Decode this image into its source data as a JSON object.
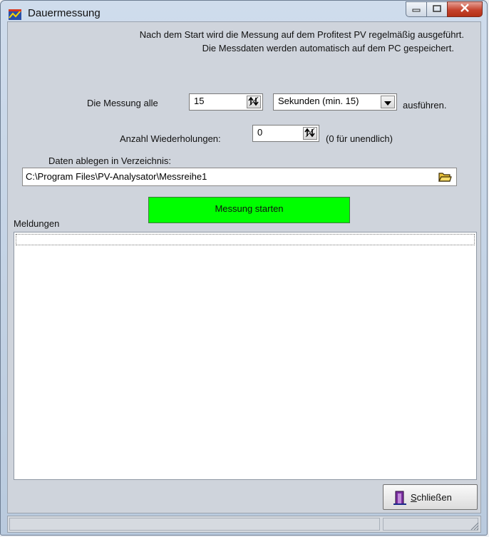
{
  "window": {
    "title": "Dauermessung"
  },
  "intro": {
    "line1": "Nach dem Start wird die Messung auf dem Profitest PV regelmäßig ausgeführt.",
    "line2": "Die Messdaten werden automatisch auf dem PC gespeichert."
  },
  "interval": {
    "prefix": "Die Messung alle",
    "value": "15",
    "unit_selected": "Sekunden (min. 15)",
    "suffix": "ausführen."
  },
  "repeat": {
    "label": "Anzahl Wiederholungen:",
    "value": "0",
    "hint": "(0 für unendlich)"
  },
  "directory": {
    "label": "Daten ablegen in Verzeichnis:",
    "path": "C:\\Program Files\\PV-Analysator\\Messreihe1"
  },
  "start_button": {
    "label": "Messung starten",
    "color": "#00ff00"
  },
  "messages": {
    "label": "Meldungen"
  },
  "close_button": {
    "accel": "S",
    "label_rest": "chließen"
  },
  "icons": [
    "app-icon",
    "minimize-icon",
    "maximize-icon",
    "close-icon",
    "spin-arrows-icon",
    "dropdown-arrow-icon",
    "folder-icon",
    "exit-door-icon",
    "resize-grip-icon"
  ]
}
